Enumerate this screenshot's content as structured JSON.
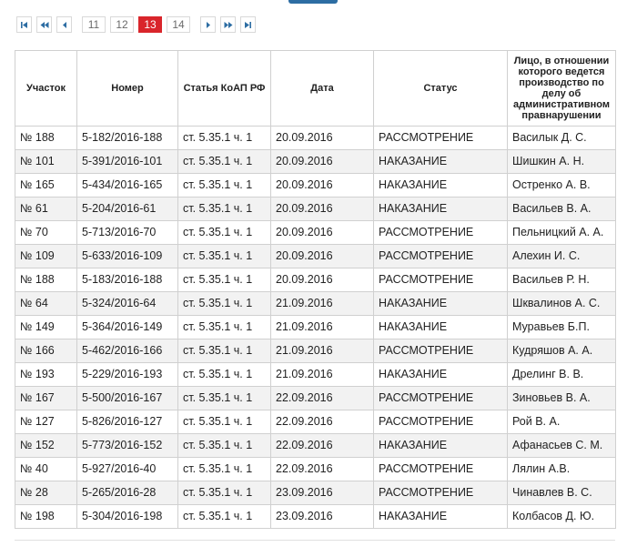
{
  "pagination": {
    "first_icon": "first-page-icon",
    "prev_block_icon": "prev-block-icon",
    "prev_icon": "prev-page-icon",
    "pages": [
      "11",
      "12",
      "13",
      "14"
    ],
    "current_page": "13",
    "next_icon": "next-page-icon",
    "next_block_icon": "next-block-icon",
    "last_icon": "last-page-icon",
    "accent_color": "#d9252b",
    "icon_color": "#2d6da3"
  },
  "table": {
    "headers": [
      "Участок",
      "Номер",
      "Статья КоАП РФ",
      "Дата",
      "Статус",
      "Лицо, в отношении которого ведется производство по делу об административном правнарушении"
    ],
    "rows": [
      [
        "№ 188",
        "5-182/2016-188",
        "ст. 5.35.1 ч. 1",
        "20.09.2016",
        "РАССМОТРЕНИЕ",
        "Василык Д. С."
      ],
      [
        "№ 101",
        "5-391/2016-101",
        "ст. 5.35.1 ч. 1",
        "20.09.2016",
        "НАКАЗАНИЕ",
        "Шишкин А. Н."
      ],
      [
        "№ 165",
        "5-434/2016-165",
        "ст. 5.35.1 ч. 1",
        "20.09.2016",
        "НАКАЗАНИЕ",
        "Остренко А. В."
      ],
      [
        "№ 61",
        "5-204/2016-61",
        "ст. 5.35.1 ч. 1",
        "20.09.2016",
        "НАКАЗАНИЕ",
        "Васильев В. А."
      ],
      [
        "№ 70",
        "5-713/2016-70",
        "ст. 5.35.1 ч. 1",
        "20.09.2016",
        "РАССМОТРЕНИЕ",
        "Пельницкий А. А."
      ],
      [
        "№ 109",
        "5-633/2016-109",
        "ст. 5.35.1 ч. 1",
        "20.09.2016",
        "РАССМОТРЕНИЕ",
        "Алехин И. С."
      ],
      [
        "№ 188",
        "5-183/2016-188",
        "ст. 5.35.1 ч. 1",
        "20.09.2016",
        "РАССМОТРЕНИЕ",
        "Васильев Р. Н."
      ],
      [
        "№ 64",
        "5-324/2016-64",
        "ст. 5.35.1 ч. 1",
        "21.09.2016",
        "НАКАЗАНИЕ",
        "Шквалинов А. С."
      ],
      [
        "№ 149",
        "5-364/2016-149",
        "ст. 5.35.1 ч. 1",
        "21.09.2016",
        "НАКАЗАНИЕ",
        "Муравьев Б.П."
      ],
      [
        "№ 166",
        "5-462/2016-166",
        "ст. 5.35.1 ч. 1",
        "21.09.2016",
        "РАССМОТРЕНИЕ",
        "Кудряшов А. А."
      ],
      [
        "№ 193",
        "5-229/2016-193",
        "ст. 5.35.1 ч. 1",
        "21.09.2016",
        "НАКАЗАНИЕ",
        "Дрелинг В. В."
      ],
      [
        "№ 167",
        "5-500/2016-167",
        "ст. 5.35.1 ч. 1",
        "22.09.2016",
        "РАССМОТРЕНИЕ",
        "Зиновьев В. А."
      ],
      [
        "№ 127",
        "5-826/2016-127",
        "ст. 5.35.1 ч. 1",
        "22.09.2016",
        "РАССМОТРЕНИЕ",
        "Рой В. А."
      ],
      [
        "№ 152",
        "5-773/2016-152",
        "ст. 5.35.1 ч. 1",
        "22.09.2016",
        "НАКАЗАНИЕ",
        "Афанасьев С. М."
      ],
      [
        "№ 40",
        "5-927/2016-40",
        "ст. 5.35.1 ч. 1",
        "22.09.2016",
        "РАССМОТРЕНИЕ",
        "Лялин А.В."
      ],
      [
        "№ 28",
        "5-265/2016-28",
        "ст. 5.35.1 ч. 1",
        "23.09.2016",
        "РАССМОТРЕНИЕ",
        "Чинавлев В. С."
      ],
      [
        "№ 198",
        "5-304/2016-198",
        "ст. 5.35.1 ч. 1",
        "23.09.2016",
        "НАКАЗАНИЕ",
        "Колбасов Д. Ю."
      ]
    ]
  }
}
